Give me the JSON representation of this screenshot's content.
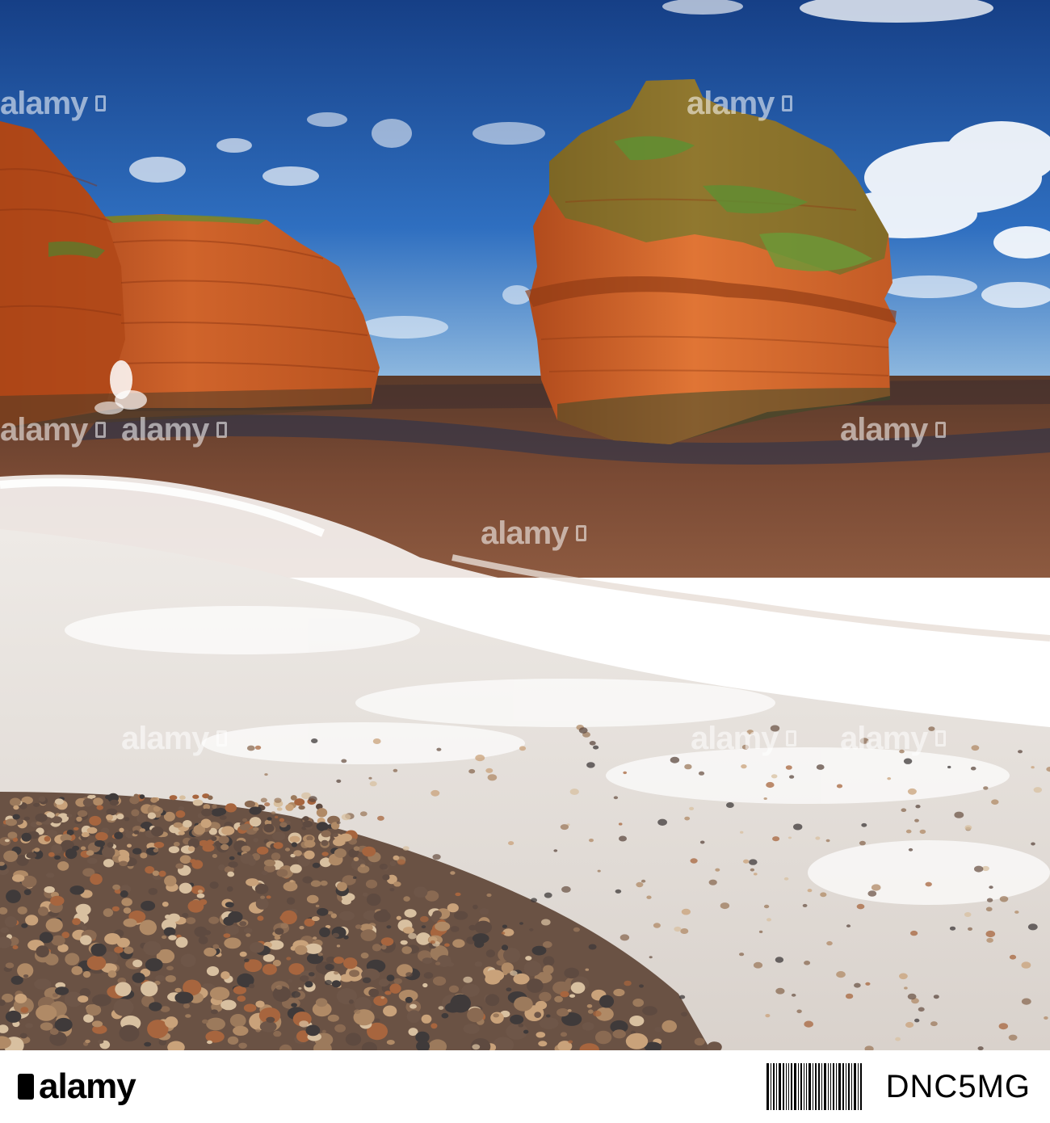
{
  "watermark": {
    "text": "alamy",
    "count": 9
  },
  "footer": {
    "logo_text": "alamy",
    "image_id": "DNC5MG"
  },
  "colors": {
    "sky_top": "#1d4f9a",
    "sky_bottom": "#6fa8dc",
    "cliff": "#c65a23",
    "sea": "#5a3b2b",
    "foam": "#f2f0ee"
  }
}
